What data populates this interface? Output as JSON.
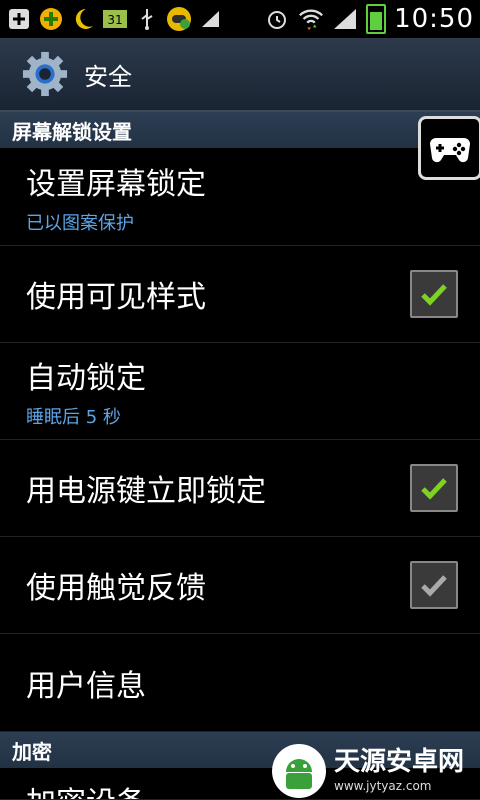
{
  "status_bar": {
    "time": "10:50",
    "icons": [
      "plus-icon",
      "app-icon",
      "moon-icon",
      "sim-icon",
      "usb-icon",
      "game-icon",
      "sail-icon",
      "alarm-icon",
      "wifi-icon",
      "signal-icon",
      "battery-icon"
    ]
  },
  "header": {
    "title": "安全"
  },
  "sections": {
    "screen_unlock": "屏幕解锁设置",
    "encryption": "加密"
  },
  "items": {
    "set_lock": {
      "title": "设置屏幕锁定",
      "subtitle": "已以图案保护"
    },
    "visible_pattern": {
      "title": "使用可见样式",
      "checked": true
    },
    "auto_lock": {
      "title": "自动锁定",
      "subtitle": "睡眠后 5 秒"
    },
    "power_lock": {
      "title": "用电源键立即锁定",
      "checked": true
    },
    "haptic": {
      "title": "使用触觉反馈",
      "checked": true
    },
    "owner_info": {
      "title": "用户信息"
    },
    "encrypt_device": {
      "title": "加密设备"
    }
  },
  "watermark": {
    "cn": "天源安卓网",
    "url": "www.jytyaz.com"
  },
  "colors": {
    "accent_blue": "#5da4e6",
    "check_green": "#7ed321",
    "check_gray": "#aaaaaa"
  }
}
